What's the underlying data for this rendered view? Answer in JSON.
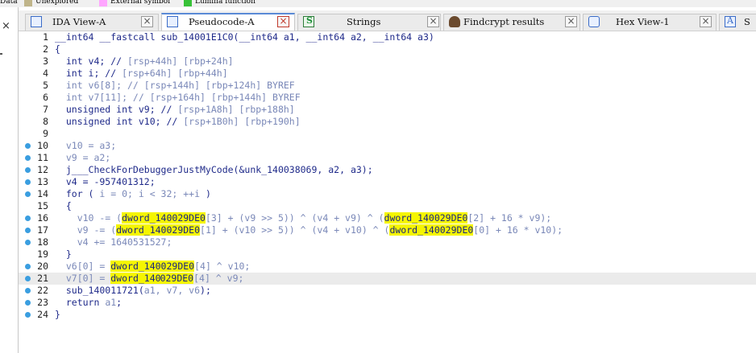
{
  "legend": [
    {
      "label": "Data",
      "color": ""
    },
    {
      "label": "Unexplored",
      "color": "#c0b58a"
    },
    {
      "label": "External symbol",
      "color": "#ffa6ff"
    },
    {
      "label": "Lumina function",
      "color": "#38c238"
    }
  ],
  "left_panel": {
    "close_glyph": "×"
  },
  "tabs": [
    {
      "label": "IDA View-A",
      "icon": "ida-view-icon",
      "active": false,
      "close": "×"
    },
    {
      "label": "Pseudocode-A",
      "icon": "pseudocode-icon",
      "active": true,
      "close": "×"
    },
    {
      "label": "Strings",
      "icon": "strings-icon",
      "active": false,
      "close": "×"
    },
    {
      "label": "Findcrypt results",
      "icon": "findcrypt-icon",
      "active": false,
      "close": "×"
    },
    {
      "label": "Hex View-1",
      "icon": "hex-view-icon",
      "active": false,
      "close": "×"
    },
    {
      "label": "S",
      "icon": "structures-icon",
      "active": false,
      "close": ""
    }
  ],
  "code": {
    "highlight_color": "#f5f500",
    "current_line": 21,
    "lines": [
      {
        "n": "1",
        "bp": false,
        "segs": [
          [
            "__int64 __fastcall sub_14001E1C0(__int64 a1, __int64 a2, __int64 a3)",
            ""
          ]
        ]
      },
      {
        "n": "2",
        "bp": false,
        "segs": [
          [
            "{",
            ""
          ]
        ]
      },
      {
        "n": "3",
        "bp": false,
        "segs": [
          [
            "  int v4; // ",
            ""
          ],
          [
            "[rsp+44h] [rbp+24h]",
            "c"
          ]
        ]
      },
      {
        "n": "4",
        "bp": false,
        "segs": [
          [
            "  int i; // ",
            ""
          ],
          [
            "[rsp+64h] [rbp+44h]",
            "c"
          ]
        ]
      },
      {
        "n": "5",
        "bp": false,
        "segs": [
          [
            "  int v6[8]; // [rsp+144h] [rbp+124h] BYREF",
            "c"
          ]
        ]
      },
      {
        "n": "6",
        "bp": false,
        "segs": [
          [
            "  int v7[11]; // [rsp+164h] [rbp+144h] BYREF",
            "c"
          ]
        ]
      },
      {
        "n": "7",
        "bp": false,
        "segs": [
          [
            "  unsigned int v9; // ",
            ""
          ],
          [
            "[rsp+1A8h] [rbp+188h]",
            "c"
          ]
        ]
      },
      {
        "n": "8",
        "bp": false,
        "segs": [
          [
            "  unsigned int v10; // ",
            ""
          ],
          [
            "[rsp+1B0h] [rbp+190h]",
            "c"
          ]
        ]
      },
      {
        "n": "9",
        "bp": false,
        "segs": [
          [
            "",
            ""
          ]
        ]
      },
      {
        "n": "10",
        "bp": true,
        "segs": [
          [
            "  v10 = a3;",
            "c"
          ]
        ]
      },
      {
        "n": "11",
        "bp": true,
        "segs": [
          [
            "  v9 = a2;",
            "c"
          ]
        ]
      },
      {
        "n": "12",
        "bp": true,
        "segs": [
          [
            "  j___CheckForDebuggerJustMyCode(&unk_140038069, a2, a3);",
            ""
          ]
        ]
      },
      {
        "n": "13",
        "bp": true,
        "segs": [
          [
            "  v4 = -957401312;",
            ""
          ]
        ]
      },
      {
        "n": "14",
        "bp": true,
        "segs": [
          [
            "  for ( ",
            ""
          ],
          [
            "i = 0; i < 32; ++i",
            "c"
          ],
          [
            " )",
            ""
          ]
        ]
      },
      {
        "n": "15",
        "bp": false,
        "segs": [
          [
            "  {",
            ""
          ]
        ]
      },
      {
        "n": "16",
        "bp": true,
        "segs": [
          [
            "    v10 -= (",
            "c"
          ],
          [
            "dword_140029DE0",
            "hl"
          ],
          [
            "[3] + (v9 >> 5)) ^ (v4 + v9) ^ (",
            "c"
          ],
          [
            "dword_140029DE0",
            "hl"
          ],
          [
            "[2] + 16 * v9);",
            "c"
          ]
        ]
      },
      {
        "n": "17",
        "bp": true,
        "segs": [
          [
            "    v9 -= (",
            "c"
          ],
          [
            "dword_140029DE0",
            "hl"
          ],
          [
            "[1] + (v10 >> 5)) ^ (v4 + v10) ^ (",
            "c"
          ],
          [
            "dword_140029DE0",
            "hl"
          ],
          [
            "[0] + 16 * v10);",
            "c"
          ]
        ]
      },
      {
        "n": "18",
        "bp": true,
        "segs": [
          [
            "    v4 += 1640531527;",
            "c"
          ]
        ]
      },
      {
        "n": "19",
        "bp": false,
        "segs": [
          [
            "  }",
            ""
          ]
        ]
      },
      {
        "n": "20",
        "bp": true,
        "segs": [
          [
            "  v6[0] = ",
            "c"
          ],
          [
            "dword_140029DE0",
            "hl"
          ],
          [
            "[4] ^ v10;",
            "c"
          ]
        ]
      },
      {
        "n": "21",
        "bp": true,
        "segs": [
          [
            "  v7[0] = ",
            "c"
          ],
          [
            "dword_140",
            "hl"
          ],
          [
            "|",
            "caret"
          ],
          [
            "029DE0",
            "hl"
          ],
          [
            "[4] ^ v9;",
            "c"
          ]
        ]
      },
      {
        "n": "22",
        "bp": true,
        "segs": [
          [
            "  sub_140011721(",
            ""
          ],
          [
            "a1, v7, v6",
            "c"
          ],
          [
            ");",
            ""
          ]
        ]
      },
      {
        "n": "23",
        "bp": true,
        "segs": [
          [
            "  return ",
            ""
          ],
          [
            "a1",
            "c"
          ],
          [
            ";",
            ""
          ]
        ]
      },
      {
        "n": "24",
        "bp": true,
        "segs": [
          [
            "}",
            ""
          ]
        ]
      }
    ]
  }
}
